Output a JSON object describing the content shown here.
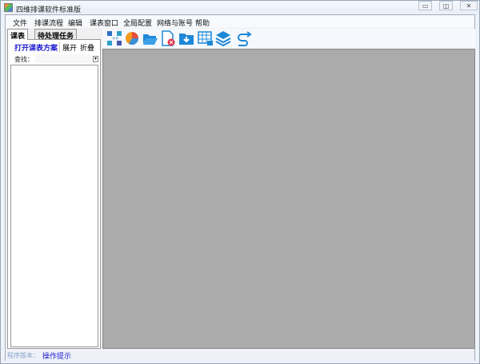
{
  "window": {
    "title": "四维排课软件标准版",
    "minimize": "▭",
    "restore": "◫",
    "close": "✕"
  },
  "menu": [
    "文件",
    "排课流程",
    "编辑",
    "课表窗口",
    "全局配置",
    "网络与账号",
    "帮助"
  ],
  "left_tabs": [
    "课表",
    "待处理任务"
  ],
  "sub_toolbar": {
    "open": "打开课表方案",
    "expand": "展开",
    "collapse": "折叠"
  },
  "search": {
    "label": "查找：",
    "value": ""
  },
  "toolbar_icons": [
    "arrange-icon",
    "pie-chart-icon",
    "open-folder-icon",
    "delete-file-icon",
    "download-folder-icon",
    "locked-table-icon",
    "layers-icon",
    "redo-arrow-icon"
  ],
  "status": {
    "version_label": "程序版本：",
    "hint": "操作提示"
  },
  "colors": {
    "accent": "#1a1ad0",
    "icon_blue": "#1e88d8",
    "workarea": "#ababab"
  }
}
